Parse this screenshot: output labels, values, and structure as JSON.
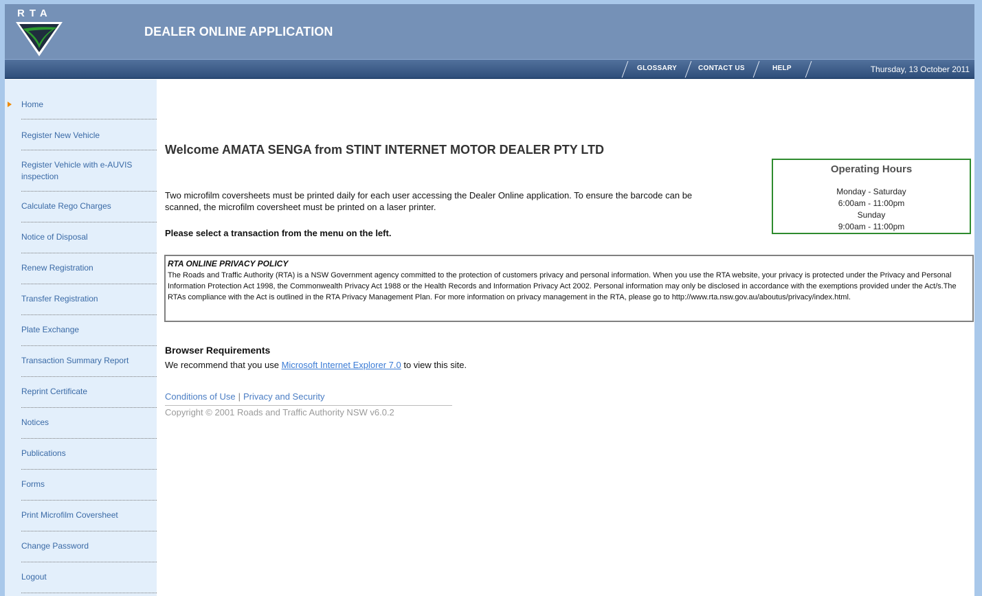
{
  "header": {
    "logo_text": "RTA",
    "app_title": "DEALER ONLINE APPLICATION"
  },
  "nav": {
    "glossary": "GLOSSARY",
    "contact": "CONTACT US",
    "help": "HELP",
    "date": "Thursday, 13 October 2011"
  },
  "sidebar": {
    "items": [
      {
        "label": "Home"
      },
      {
        "label": "Register New Vehicle"
      },
      {
        "label": "Register Vehicle with e-AUVIS inspection"
      },
      {
        "label": "Calculate Rego Charges"
      },
      {
        "label": "Notice of Disposal"
      },
      {
        "label": "Renew Registration"
      },
      {
        "label": "Transfer Registration"
      },
      {
        "label": "Plate Exchange"
      },
      {
        "label": "Transaction Summary Report"
      },
      {
        "label": "Reprint Certificate"
      },
      {
        "label": "Notices"
      },
      {
        "label": "Publications"
      },
      {
        "label": "Forms"
      },
      {
        "label": "Print Microfilm Coversheet"
      },
      {
        "label": "Change Password"
      },
      {
        "label": "Logout"
      }
    ]
  },
  "main": {
    "welcome": "Welcome AMATA SENGA from STINT INTERNET MOTOR DEALER PTY LTD",
    "coversheet_text": "Two microfilm coversheets must be printed daily for each user accessing the Dealer Online application. To ensure the barcode can be scanned, the microfilm coversheet must be printed on a laser printer.",
    "select_msg": "Please select a transaction from the menu on the left.",
    "hours": {
      "title": "Operating Hours",
      "line1": "Monday - Saturday",
      "line2": "6:00am - 11:00pm",
      "line3": "Sunday",
      "line4": "9:00am - 11:00pm"
    },
    "privacy": {
      "title": "RTA ONLINE PRIVACY POLICY",
      "body": "The Roads and Traffic Authority (RTA) is a NSW Government agency committed to the protection of customers privacy and personal information. When you use the RTA website, your privacy is protected under the Privacy and Personal Information Protection Act 1998, the Commonwealth Privacy Act 1988 or the Health Records and Information Privacy Act 2002. Personal information may only be disclosed in accordance with the exemptions provided under the Act/s.The RTAs compliance with the Act is outlined in the RTA Privacy Management Plan. For more information on privacy management in the RTA, please go to http://www.rta.nsw.gov.au/aboutus/privacy/index.html."
    },
    "browser": {
      "title": "Browser Requirements",
      "prefix": "We recommend that you use ",
      "link": "Microsoft Internet Explorer 7.0",
      "suffix": " to view this site."
    },
    "footer": {
      "conditions": "Conditions of Use",
      "separator": "|",
      "privacy": "Privacy and Security",
      "copyright": "Copyright © 2001 Roads and Traffic Authority NSW v6.0.2"
    }
  }
}
